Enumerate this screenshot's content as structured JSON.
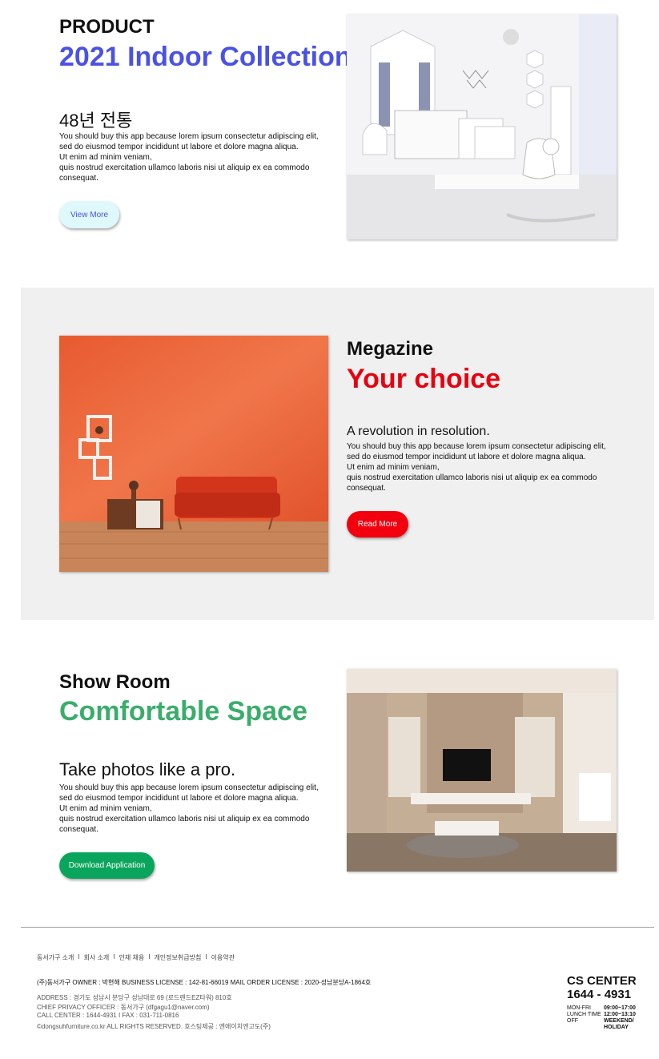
{
  "sec1": {
    "category": "PRODUCT",
    "title": "2021 Indoor Collection",
    "subtitle": "48년 전통",
    "body": "You should buy this app because lorem ipsum consectetur adipiscing elit,\nsed do eiusmod tempor incididunt ut labore et dolore magna aliqua.\nUt enim ad minim veniam,\nquis nostrud exercitation ullamco laboris nisi ut aliquip ex ea commodo consequat.",
    "button": "View More",
    "title_color": "#4a52e6"
  },
  "sec2": {
    "category": "Megazine",
    "title": "Your choice",
    "subtitle": "A revolution in resolution.",
    "body": "You should buy this app because lorem ipsum consectetur adipiscing elit,\nsed do eiusmod tempor incididunt ut labore et dolore magna aliqua.\nUt enim ad minim veniam,\nquis nostrud exercitation ullamco laboris nisi ut aliquip ex ea commodo consequat.",
    "button": "Read More",
    "title_color": "#e8000f"
  },
  "sec3": {
    "category": "Show Room",
    "title": "Comfortable Space",
    "subtitle": "Take photos like a pro.",
    "body": "You should buy this app because lorem ipsum consectetur adipiscing elit,\nsed do eiusmod tempor incididunt ut labore et dolore magna aliqua.\nUt enim ad minim veniam,\nquis nostrud exercitation ullamco laboris nisi ut aliquip ex ea commodo consequat.",
    "button": "Download Application",
    "title_color": "#3aad6b"
  },
  "footer": {
    "links": [
      "동서가구 소개",
      "회사 소개",
      "인재 채용",
      "개인정보취급방침",
      "이용약관"
    ],
    "company_line": "(주)동서가구   OWNER : 박현해   BUSINESS LICENSE : 142-81-66019   MAIL ORDER LICENSE : 2020-성남분당A-1864호",
    "address": "ADDRESS : 경기도 성남시 분당구 성남대로 69 (로드렌드EZ타워) 810호",
    "privacy": "CHIEF PRIVACY OFFICER : 동서가구 (dfgagu1@naver.com)",
    "call": "CALL CENTER : 1644-4931 I FAX : 031-711-0816",
    "copyright": "©dongsuhfurniture.co.kr ALL RIGHTS RESERVED. 호스팅제공 : 엔에이치엔고도(주)",
    "cs_title": "CS CENTER",
    "cs_phone": "1644 - 4931",
    "hours": [
      {
        "label": "MON-FRI",
        "value": "09:00~17:00"
      },
      {
        "label": "LUNCH TIME",
        "value": "12:00~13:10"
      },
      {
        "label": "OFF",
        "value": "WEEKEND/ HOLIDAY"
      }
    ]
  }
}
